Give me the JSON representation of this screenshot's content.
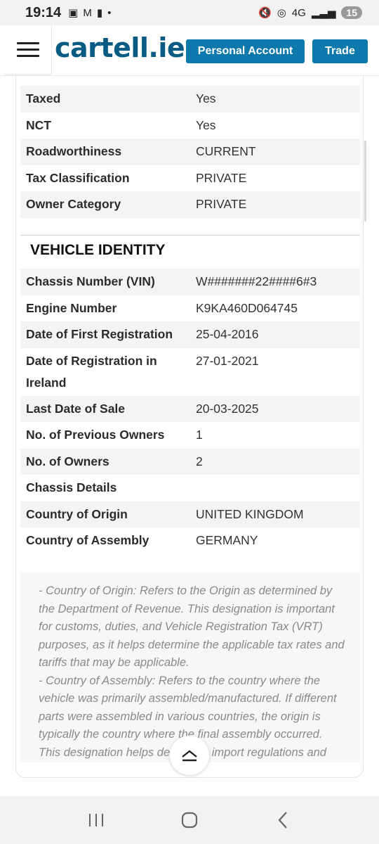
{
  "status_bar": {
    "time": "19:14",
    "network": "4G",
    "battery": "15",
    "icons": [
      "screenshot-icon",
      "gmail-icon",
      "alert-icon",
      "dot-icon",
      "mute-icon",
      "hotspot-icon",
      "signal-icon"
    ]
  },
  "header": {
    "logo": "cartell.ie",
    "personal_account_label": "Personal Account",
    "trade_label": "Trade",
    "brand_color": "#0a5b84",
    "button_color": "#0d78ac"
  },
  "status_rows": [
    {
      "label": "Taxed",
      "value": "Yes"
    },
    {
      "label": "NCT",
      "value": "Yes"
    },
    {
      "label": "Roadworthiness",
      "value": "CURRENT"
    },
    {
      "label": "Tax Classification",
      "value": "PRIVATE"
    },
    {
      "label": "Owner Category",
      "value": "PRIVATE"
    }
  ],
  "vehicle_identity": {
    "title": "VEHICLE IDENTITY",
    "rows": [
      {
        "label": "Chassis Number (VIN)",
        "value": "W#######22####6#3"
      },
      {
        "label": "Engine Number",
        "value": "K9KA460D064745"
      },
      {
        "label": "Date of First Registration",
        "value": "25-04-2016"
      },
      {
        "label": "Date of Registration in Ireland",
        "value": "27-01-2021"
      },
      {
        "label": "Last Date of Sale",
        "value": "20-03-2025"
      },
      {
        "label": "No. of Previous Owners",
        "value": "1"
      },
      {
        "label": "No. of Owners",
        "value": "2"
      },
      {
        "label": "Chassis Details",
        "value": ""
      },
      {
        "label": "Country of Origin",
        "value": "UNITED KINGDOM"
      },
      {
        "label": "Country of Assembly",
        "value": "GERMANY"
      }
    ]
  },
  "notes": {
    "origin": "- Country of Origin: Refers to the Origin as determined by the Department of Revenue. This designation is important for customs, duties, and Vehicle Registration Tax (VRT) purposes, as it helps determine the applicable tax rates and tariffs that may be applicable.",
    "assembly": "- Country of Assembly: Refers to the country where the vehicle was primarily assembled/manufactured. If different parts were assembled in various countries, the origin is typically the country where the final assembly occurred. This designation helps determine import regulations and tariffs."
  }
}
